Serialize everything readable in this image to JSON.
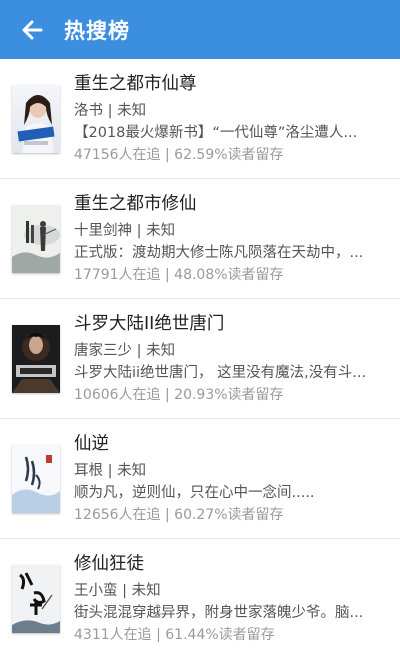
{
  "header": {
    "title": "热搜榜",
    "back_icon": "arrow-left-icon",
    "background": "#3c8fe0"
  },
  "books": [
    {
      "title": "重生之都市仙尊",
      "author": "洛书",
      "status": "未知",
      "intro": "【2018最火爆新书】“一代仙尊”洛尘遭人...",
      "followers": "47156人在追",
      "retention": "62.59%读者留存"
    },
    {
      "title": "重生之都市修仙",
      "author": "十里剑神",
      "status": "未知",
      "intro": "正式版：渡劫期大修士陈凡陨落在天劫中，...",
      "followers": "17791人在追",
      "retention": "48.08%读者留存"
    },
    {
      "title": "斗罗大陆II绝世唐门",
      "author": "唐家三少",
      "status": "未知",
      "intro": "斗罗大陆ii绝世唐门， 这里没有魔法,没有斗...",
      "followers": "10606人在追",
      "retention": "20.93%读者留存"
    },
    {
      "title": "仙逆",
      "author": "耳根",
      "status": "未知",
      "intro": "顺为凡，逆则仙，只在心中一念间.....",
      "followers": "12656人在追",
      "retention": "60.27%读者留存"
    },
    {
      "title": "修仙狂徒",
      "author": "王小蛮",
      "status": "未知",
      "intro": "街头混混穿越异界，附身世家落魄少爷。脑...",
      "followers": "4311人在追",
      "retention": "61.44%读者留存"
    }
  ]
}
